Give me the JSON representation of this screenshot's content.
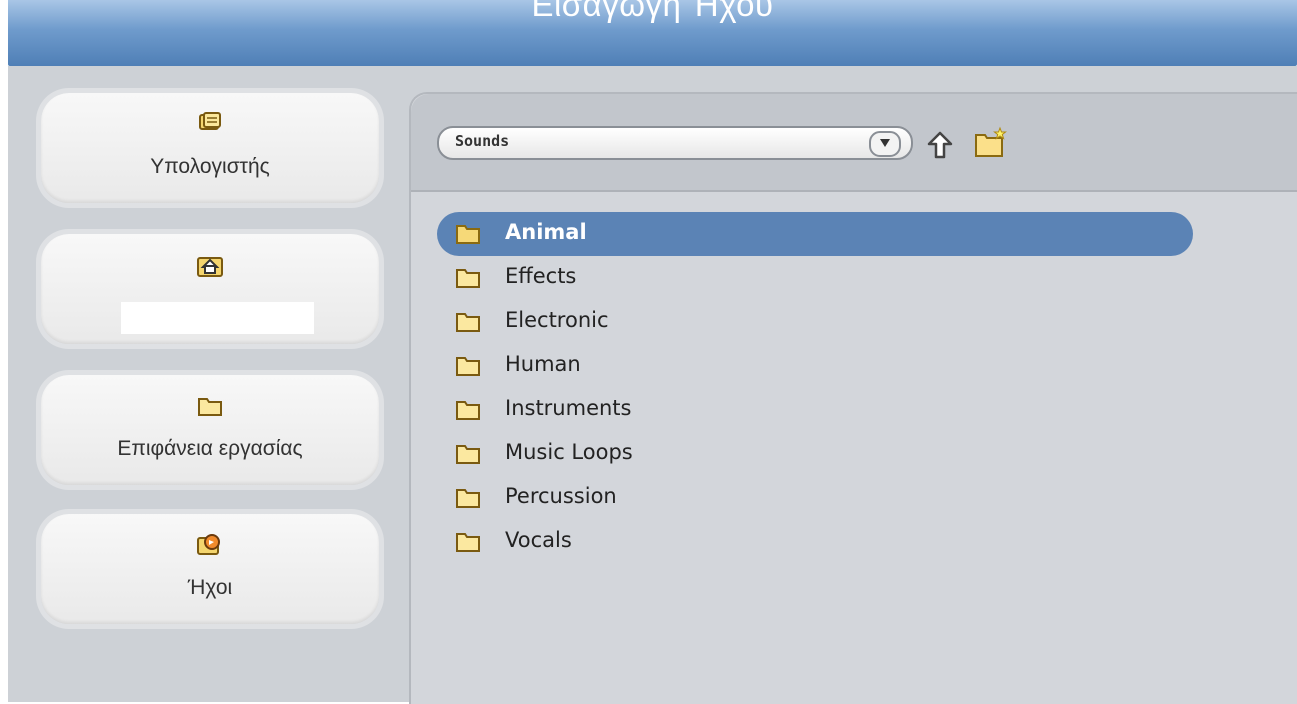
{
  "window": {
    "title": "Εισαγωγή Ήχου"
  },
  "sidebar": {
    "buttons": [
      {
        "label": "Υπολογιστής",
        "icon": "computer-icon"
      },
      {
        "label": "",
        "icon": "home-icon"
      },
      {
        "label": "Επιφάνεια εργασίας",
        "icon": "folder-icon"
      },
      {
        "label": "Ήχοι",
        "icon": "sounds-icon"
      }
    ]
  },
  "toolbar": {
    "location_value": "Sounds",
    "up_icon": "up-arrow-icon",
    "new_folder_icon": "new-folder-icon"
  },
  "file_list": {
    "selected": "Animal",
    "items": [
      {
        "name": "Animal"
      },
      {
        "name": "Effects"
      },
      {
        "name": "Electronic"
      },
      {
        "name": "Human"
      },
      {
        "name": "Instruments"
      },
      {
        "name": "Music Loops"
      },
      {
        "name": "Percussion"
      },
      {
        "name": "Vocals"
      }
    ]
  },
  "colors": {
    "title_bar": "#5b8cc3",
    "selection": "#5b83b5",
    "panel": "#d3d6db",
    "folder": "#f6d978"
  }
}
